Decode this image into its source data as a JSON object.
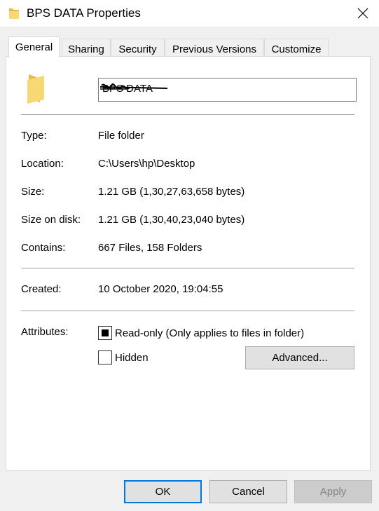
{
  "window": {
    "title": "BPS DATA Properties"
  },
  "tabs": [
    "General",
    "Sharing",
    "Security",
    "Previous Versions",
    "Customize"
  ],
  "folder_name": "BPS DATA",
  "properties": [
    {
      "label": "Type:",
      "value": "File folder"
    },
    {
      "label": "Location:",
      "value": "C:\\Users\\hp\\Desktop"
    },
    {
      "label": "Size:",
      "value": "1.21 GB (1,30,27,63,658 bytes)"
    },
    {
      "label": "Size on disk:",
      "value": "1.21 GB (1,30,40,23,040 bytes)"
    },
    {
      "label": "Contains:",
      "value": "667 Files, 158 Folders"
    }
  ],
  "created": {
    "label": "Created:",
    "value": "10 October 2020, 19:04:55"
  },
  "attributes": {
    "label": "Attributes:",
    "readonly_label": "Read-only (Only applies to files in folder)",
    "readonly_state": "indeterminate",
    "hidden_label": "Hidden",
    "hidden_checked": false,
    "advanced_label": "Advanced..."
  },
  "buttons": {
    "ok": "OK",
    "cancel": "Cancel",
    "apply": "Apply"
  },
  "colors": {
    "accent": "#0078d7",
    "folder": "#f8d775"
  }
}
